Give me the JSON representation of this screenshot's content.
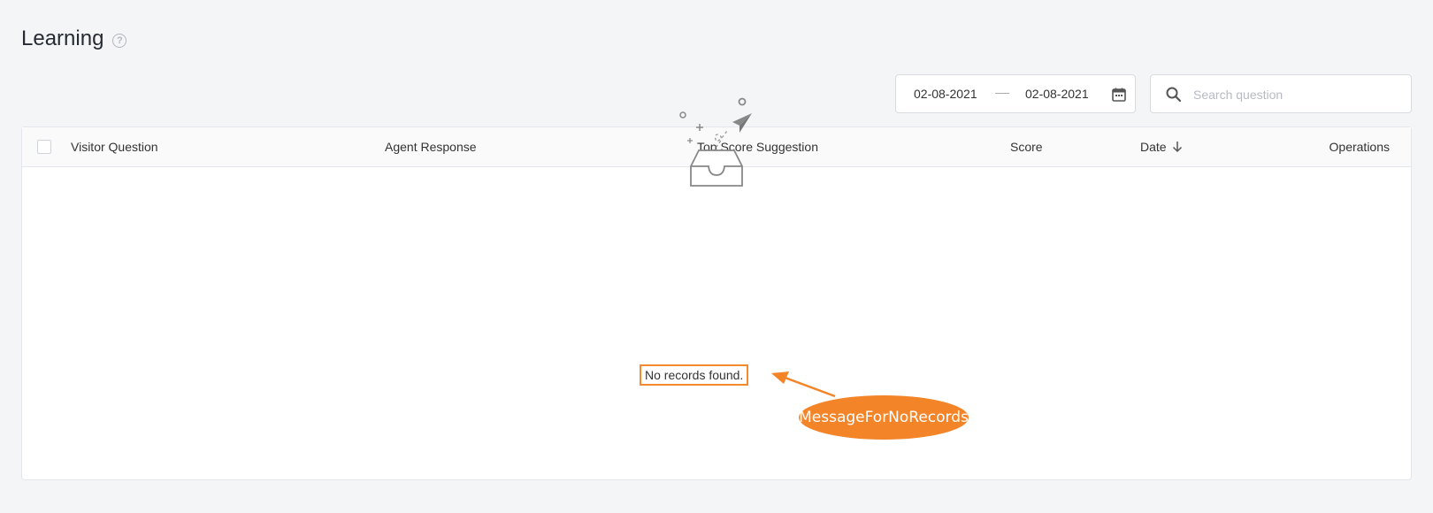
{
  "page": {
    "title": "Learning"
  },
  "filters": {
    "date_start": "02-08-2021",
    "date_end": "02-08-2021",
    "search_placeholder": "Search question"
  },
  "table": {
    "columns": [
      "Visitor Question",
      "Agent Response",
      "Top Score Suggestion",
      "Score",
      "Date",
      "Operations"
    ],
    "sort_column": "Date",
    "sort_direction": "desc",
    "empty_message": "No records found."
  },
  "annotation": {
    "label": "MessageForNoRecords",
    "color": "#f48428"
  },
  "icons": [
    "help-icon",
    "calendar-icon",
    "search-icon",
    "sort-down-icon",
    "empty-inbox-icon"
  ]
}
